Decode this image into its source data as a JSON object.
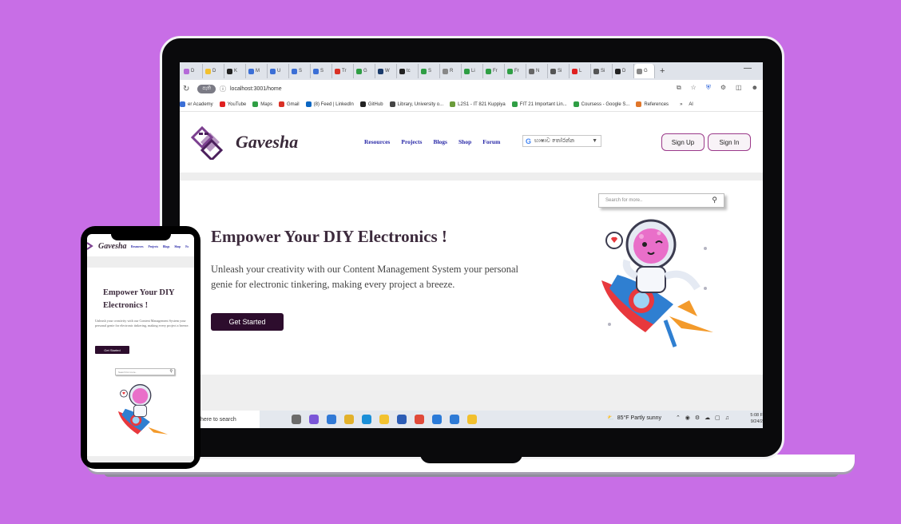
{
  "colors": {
    "background": "#c86ee6",
    "brand_dark": "#2d0d2d",
    "nav_link": "#2a2aa8",
    "accent_border": "#9b3a8a"
  },
  "browser": {
    "tabs": [
      "D",
      "D",
      "K",
      "M",
      "U",
      "S",
      "S",
      "Tr",
      "G",
      "W",
      "tc",
      "S",
      "R",
      "Li",
      "Fr",
      "Fr",
      "N",
      "Si",
      "L",
      "Si",
      "D",
      "G"
    ],
    "new_tab_symbol": "+",
    "minimize_symbol": "—",
    "profile_chip": "පැති",
    "url": "localhost:3001/home",
    "bookmarks": [
      {
        "label": "er Academy",
        "color": "#3b6fd6"
      },
      {
        "label": "YouTube",
        "color": "#e02020"
      },
      {
        "label": "Maps",
        "color": "#2f9e44"
      },
      {
        "label": "Gmail",
        "color": "#d93025"
      },
      {
        "label": "(8) Feed | LinkedIn",
        "color": "#0a66c2"
      },
      {
        "label": "GitHub",
        "color": "#222"
      },
      {
        "label": "Library, University o...",
        "color": "#444"
      },
      {
        "label": "L2S1 - IT 821 Kuppiya",
        "color": "#6a9b3a"
      },
      {
        "label": "FIT 21 Important Lin...",
        "color": "#2f9e44"
      },
      {
        "label": "Coursess - Google S...",
        "color": "#2f9e44"
      },
      {
        "label": "References",
        "color": "#e0762a"
      }
    ],
    "bookmarks_more": "»",
    "bookmarks_folder": "Al"
  },
  "site": {
    "logo_text": "Gavesha",
    "nav": [
      "Resources",
      "Projects",
      "Blogs",
      "Shop",
      "Forum"
    ],
    "translate_label": "භාෂාව තෝරන්න",
    "translate_arrow": "▼",
    "signup_label": "Sign Up",
    "signin_label": "Sign In",
    "search_placeholder": "Search for more..",
    "hero_title": "Empower Your DIY Electronics !",
    "hero_text": "Unleash your creativity with our Content Management System your personal genie for electronic tinkering, making every project a breeze.",
    "cta_label": "Get Started"
  },
  "taskbar": {
    "search_text": "here to search",
    "weather": "85°F  Partly sunny",
    "clock_time": "5:08 F",
    "clock_date": "9/24/2"
  },
  "phone": {
    "logo_text": "Gavesha",
    "nav": [
      "Resources",
      "Projects",
      "Blogs",
      "Shop",
      "Fo"
    ],
    "hero_title": "Empower Your DIY Electronics !",
    "hero_text": "Unleash your creativity with our Content Management System your personal genie for electronic tinkering, making every project a breeze.",
    "cta_label": "Get Started",
    "search_placeholder": "Search for more.."
  }
}
